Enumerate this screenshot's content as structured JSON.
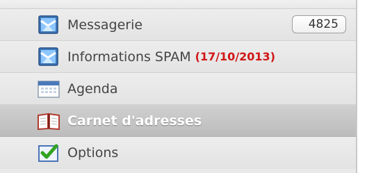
{
  "menu": {
    "items": [
      {
        "label": "Messagerie",
        "icon": "messagerie-icon",
        "badge": "4825",
        "active": false
      },
      {
        "label": "Informations SPAM",
        "date": "(17/10/2013)",
        "icon": "spam-info-icon",
        "active": false
      },
      {
        "label": "Agenda",
        "icon": "calendar-icon",
        "active": false
      },
      {
        "label": "Carnet d'adresses",
        "icon": "address-book-icon",
        "active": true
      },
      {
        "label": "Options",
        "icon": "options-checkmark-icon",
        "active": false
      }
    ],
    "colors": {
      "date_highlight": "#d11616",
      "active_text": "#ffffff",
      "active_bg": "#c2c2c2",
      "item_bg": "#e9e9e9"
    }
  }
}
